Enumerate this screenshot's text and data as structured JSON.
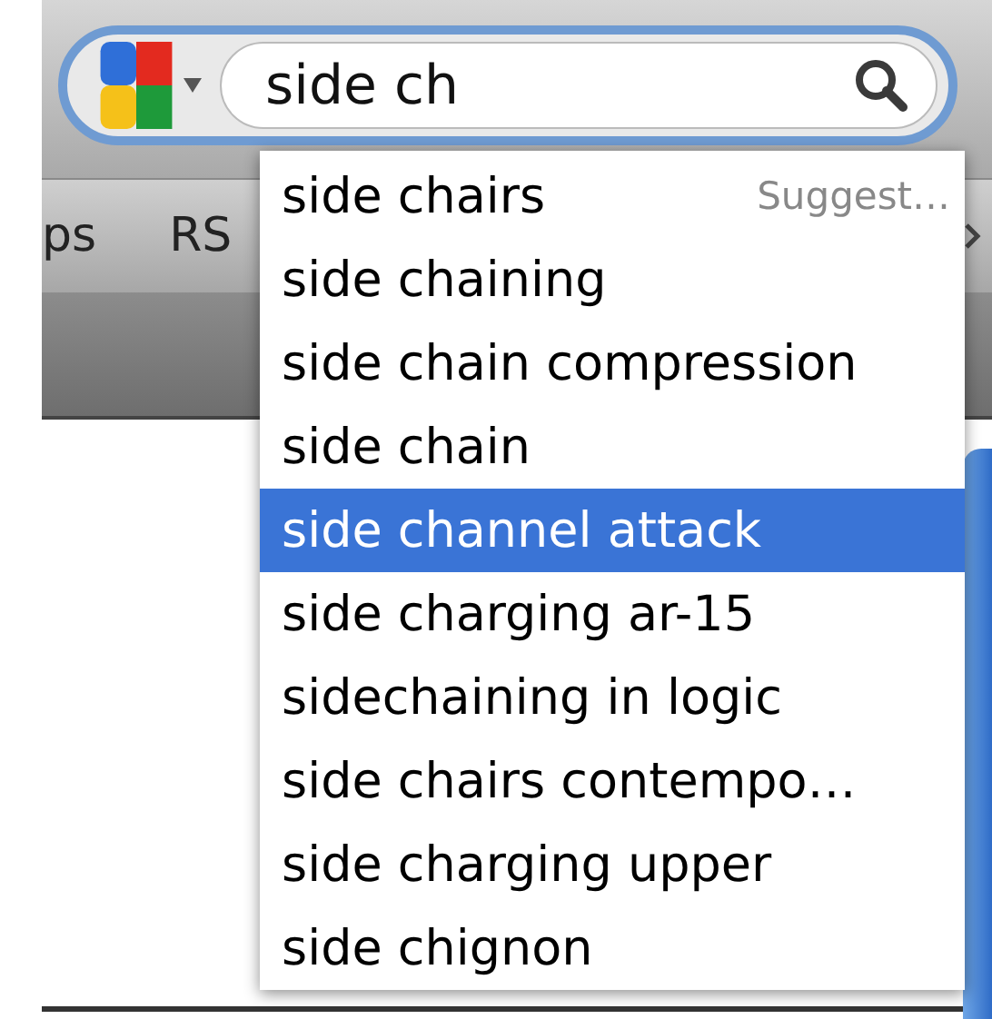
{
  "search": {
    "value": "side ch"
  },
  "bookmarks": [
    "ps",
    "RS"
  ],
  "suggestions": [
    {
      "text": "side chairs",
      "hint": "Suggest…",
      "selected": false
    },
    {
      "text": "side chaining",
      "selected": false
    },
    {
      "text": "side chain compression",
      "selected": false
    },
    {
      "text": "side chain",
      "selected": false
    },
    {
      "text": "side channel attack",
      "selected": true
    },
    {
      "text": "side charging ar-15",
      "selected": false
    },
    {
      "text": "sidechaining in logic",
      "selected": false
    },
    {
      "text": "side chairs contempo…",
      "selected": false
    },
    {
      "text": "side charging upper",
      "selected": false
    },
    {
      "text": "side chignon",
      "selected": false
    }
  ]
}
